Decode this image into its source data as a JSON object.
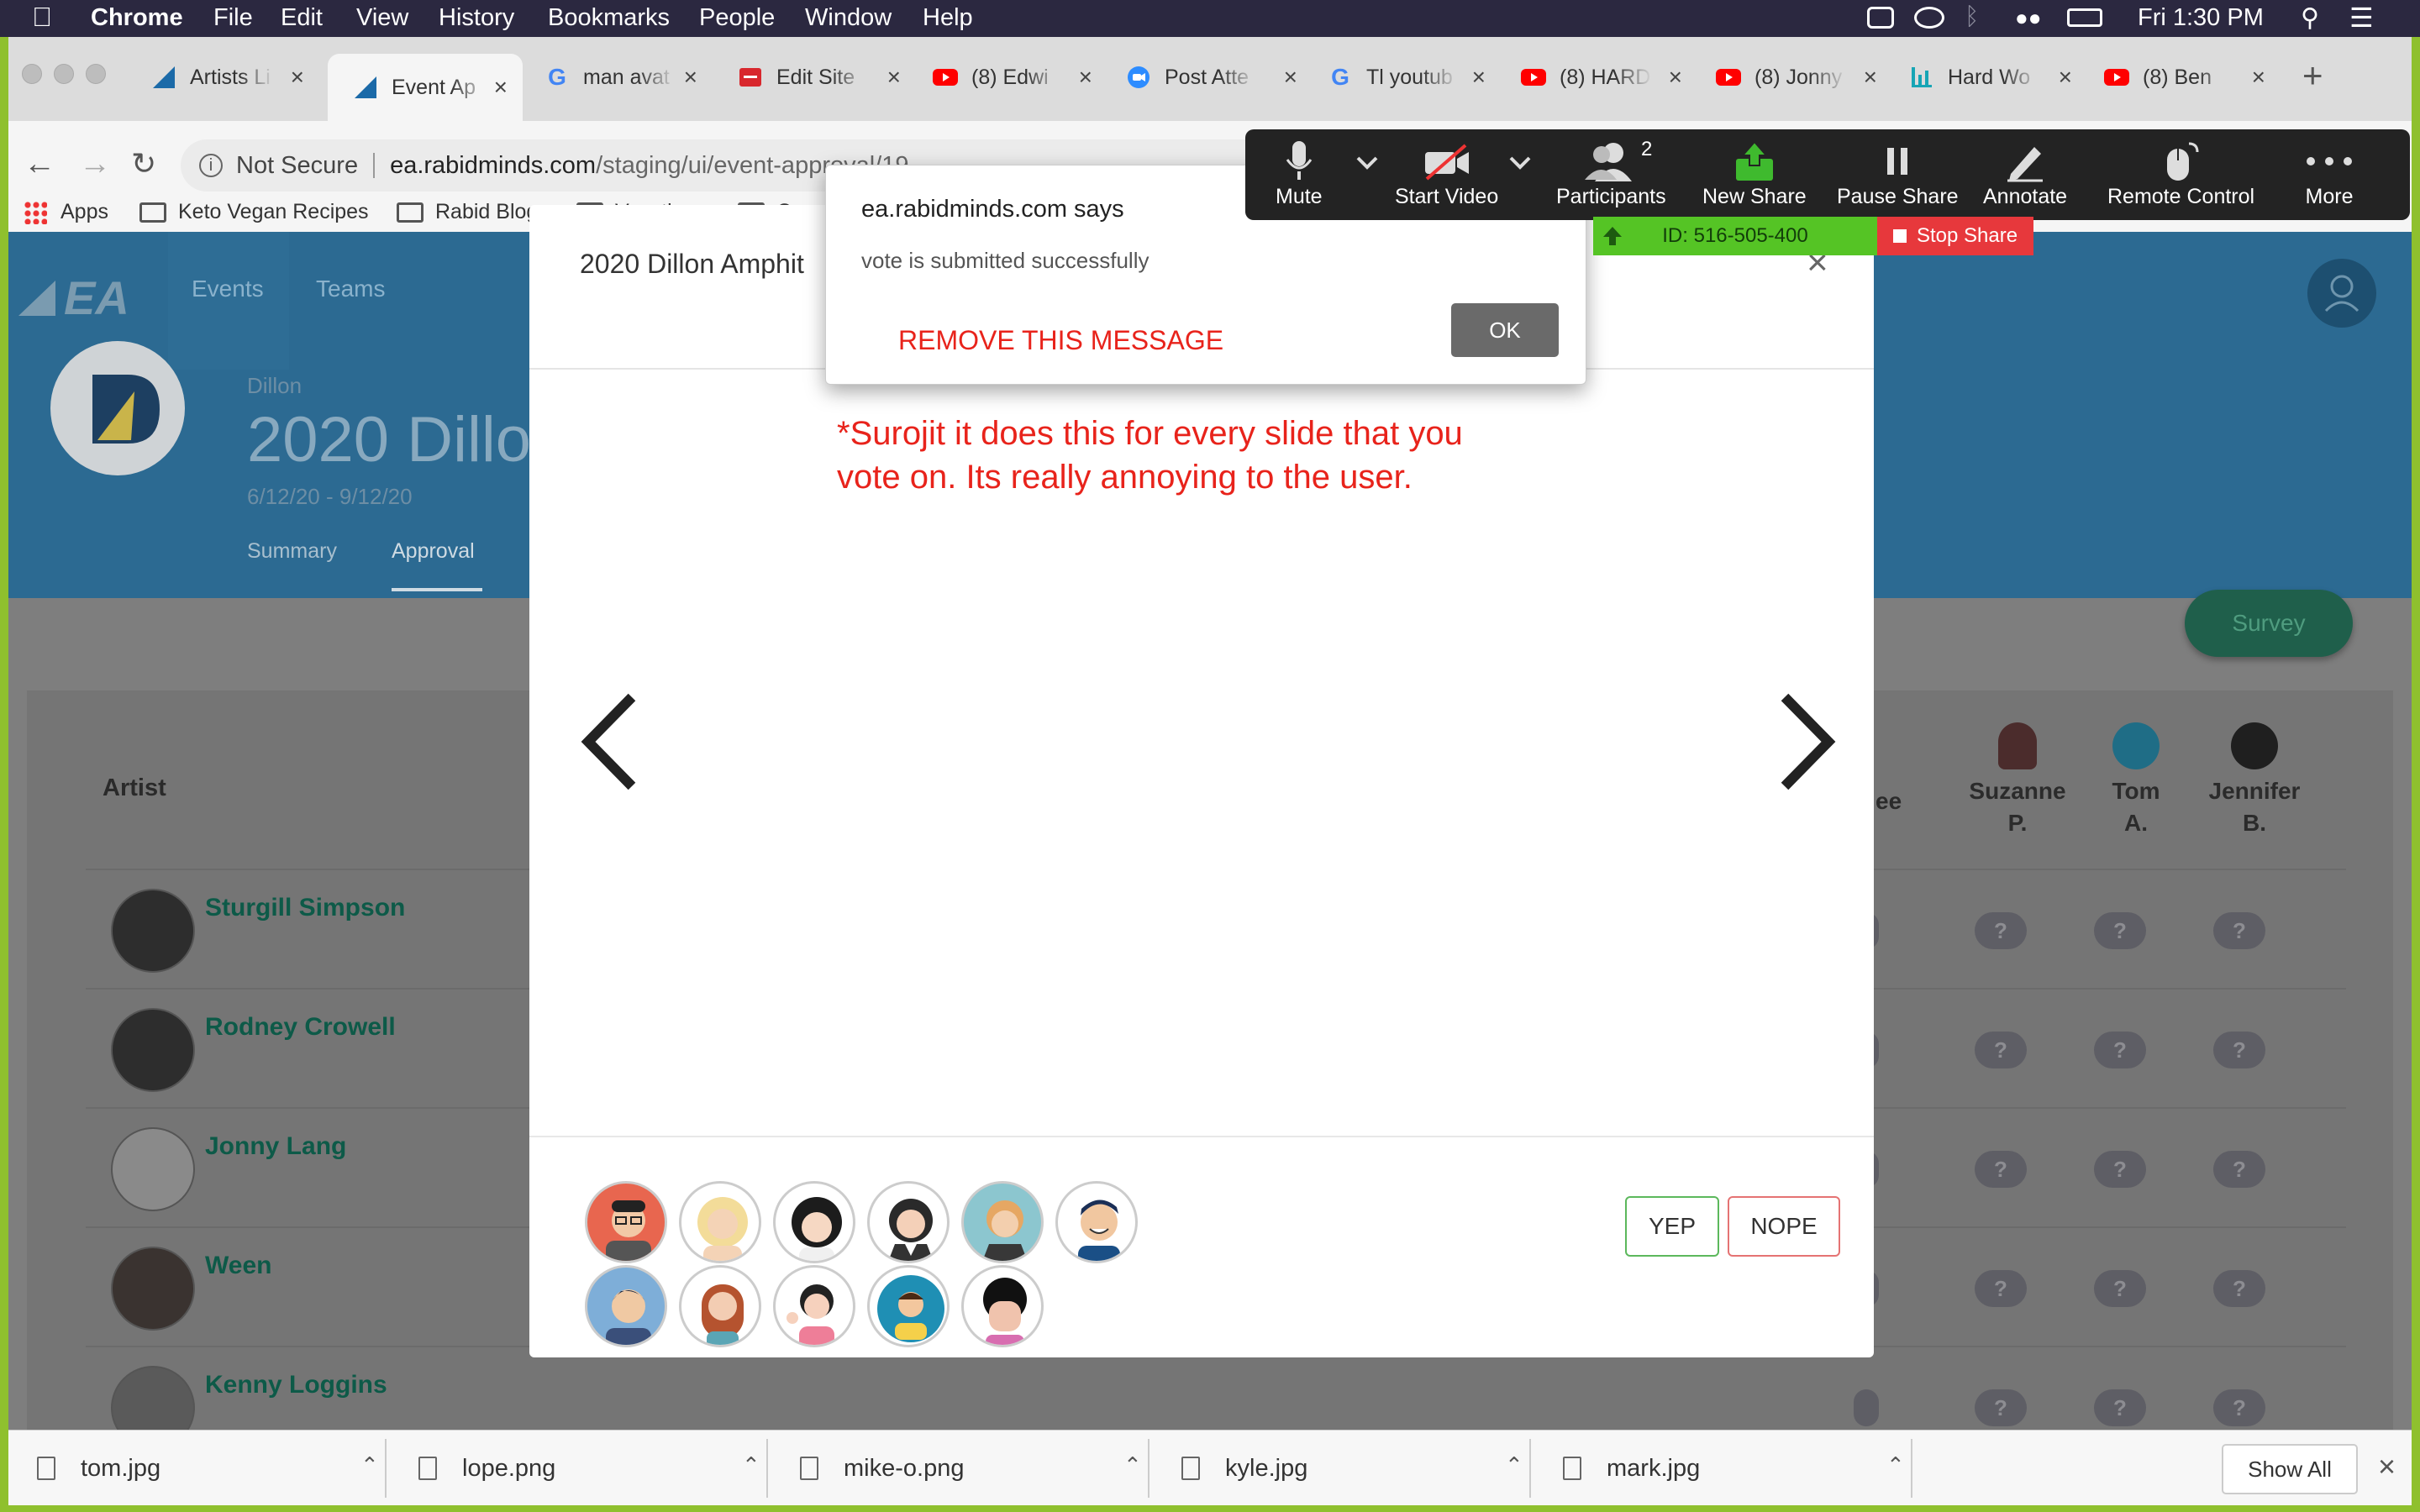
{
  "menubar": {
    "app": "Chrome",
    "items": [
      "File",
      "Edit",
      "View",
      "History",
      "Bookmarks",
      "People",
      "Window",
      "Help"
    ],
    "clock": "Fri 1:30 PM"
  },
  "tabs": [
    {
      "title": "Artists Li",
      "icon": "ea-logo-icon"
    },
    {
      "title": "Event Ap",
      "icon": "ea-logo-icon",
      "active": true
    },
    {
      "title": "man avat",
      "icon": "google-icon"
    },
    {
      "title": "Edit Site",
      "icon": "site-editor-icon"
    },
    {
      "title": "(8) Edwi",
      "icon": "youtube-icon"
    },
    {
      "title": "Post Atte",
      "icon": "zoom-icon"
    },
    {
      "title": "Tl youtub",
      "icon": "google-icon"
    },
    {
      "title": "(8) HARD",
      "icon": "youtube-icon"
    },
    {
      "title": "(8) Jonny",
      "icon": "youtube-icon"
    },
    {
      "title": "Hard Wo",
      "icon": "chart-icon"
    },
    {
      "title": "(8) Ben",
      "icon": "youtube-icon"
    }
  ],
  "address": {
    "security": "Not Secure",
    "host": "ea.rabidminds.com",
    "path": "/staging/ui/event-approval/19"
  },
  "bookmarks": [
    "Apps",
    "Keto Vegan Recipes",
    "Rabid Blogs",
    "Vacations",
    "Conce"
  ],
  "site": {
    "logo": "EA",
    "nav": [
      "Events",
      "Teams"
    ],
    "venue_small": "Dillon",
    "event_title": "2020 Dillo",
    "dates": "6/12/20 - 9/12/20",
    "subtabs": [
      "Summary",
      "Approval"
    ],
    "survey_button": "Survey",
    "artist_header": "Artist",
    "voters": [
      {
        "first": "",
        "last": "ee"
      },
      {
        "first": "Suzanne",
        "last": "P."
      },
      {
        "first": "Tom",
        "last": "A."
      },
      {
        "first": "Jennifer",
        "last": "B."
      }
    ],
    "artists": [
      "Sturgill Simpson",
      "Rodney Crowell",
      "Jonny Lang",
      "Ween",
      "Kenny Loggins"
    ],
    "vote_placeholder": "?"
  },
  "modal": {
    "title": "2020 Dillon Amphit",
    "annotation_line1": "*Surojit it does this for every slide that you",
    "annotation_line2": "vote on. Its really annoying to the user.",
    "yep": "YEP",
    "nope": "NOPE",
    "close": "×"
  },
  "alert": {
    "origin": "ea.rabidminds.com says",
    "message": "vote is submitted successfully",
    "annotation": "REMOVE THIS MESSAGE",
    "ok": "OK"
  },
  "zoom": {
    "buttons": [
      "Mute",
      "Start Video",
      "Participants",
      "New Share",
      "Pause Share",
      "Annotate",
      "Remote Control",
      "More"
    ],
    "participant_count": "2",
    "meeting_id": "ID: 516-505-400",
    "stop_share": "Stop Share"
  },
  "downloads": [
    "tom.jpg",
    "lope.png",
    "mike-o.png",
    "kyle.jpg",
    "mark.jpg"
  ],
  "show_all": "Show All",
  "colors": {
    "accent": "#2c6a92",
    "annotation_red": "#e8231b",
    "artist_link": "#0d5a48",
    "survey": "#1f8c62"
  }
}
